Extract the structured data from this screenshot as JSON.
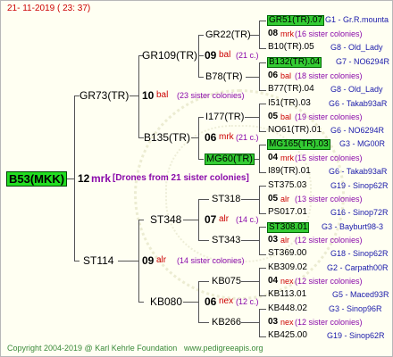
{
  "header": {
    "date": "21- 11-2019 ( 23: 37)"
  },
  "footer": {
    "copyright": "Copyright 2004-2019 @ Karl Kehrle Foundation",
    "site": "www.pedigreeapis.org"
  },
  "colors": {
    "highlight": "#33cc33",
    "code": "#1a1aaa",
    "breed_note": "#cc0000"
  },
  "root": {
    "name": "B53(MKK)",
    "num": "12",
    "race": "mrk",
    "note": "[Drones from 21 sister colonies]"
  },
  "gen1": {
    "sire": {
      "name": "GR73(TR)",
      "num": "10",
      "race": "bal",
      "colonies": "(23 sister colonies)"
    },
    "dam": {
      "name": "ST114",
      "num": "09",
      "race": "alr",
      "colonies": "(14 sister colonies)"
    }
  },
  "gen2": {
    "ss": {
      "name": "GR109(TR)",
      "num": "09",
      "race": "bal",
      "colonies": "(21 c.)"
    },
    "sd": {
      "name": "B135(TR)",
      "num": "06",
      "race": "mrk",
      "colonies": "(21 c.)"
    },
    "ds": {
      "name": "ST348",
      "num": "07",
      "race": "alr",
      "colonies": "(14 c.)"
    },
    "dd": {
      "name": "KB080",
      "num": "06",
      "race": "nex",
      "colonies": "(12 c.)"
    }
  },
  "gen3": [
    {
      "name": "GR22(TR)"
    },
    {
      "name": "B78(TR)"
    },
    {
      "name": "I177(TR)"
    },
    {
      "name": "MG60(TR)"
    },
    {
      "name": "ST318"
    },
    {
      "name": "ST343"
    },
    {
      "name": "KB075"
    },
    {
      "name": "KB266"
    }
  ],
  "gen4": [
    {
      "top": "GR51(TR).07",
      "top_code": "G1 - Gr.R.mounta",
      "num": "08",
      "race": "mrk",
      "colonies": "(16 sister colonies)",
      "bottom": "B10(TR).05",
      "bottom_code": "G8 - Old_Lady"
    },
    {
      "top": "B132(TR).04",
      "top_code": "G7 - NO6294R",
      "num": "06",
      "race": "bal",
      "colonies": "(18 sister colonies)",
      "bottom": "B77(TR).04",
      "bottom_code": "G8 - Old_Lady"
    },
    {
      "top": "I51(TR).03",
      "top_code": "G6 - Takab93aR",
      "num": "05",
      "race": "bal",
      "colonies": "(19 sister colonies)",
      "bottom": "NO61(TR).01",
      "bottom_code": "G6 - NO6294R"
    },
    {
      "top": "MG165(TR).03",
      "top_code": "G3 - MG00R",
      "num": "04",
      "race": "mrk",
      "colonies": "(15 sister colonies)",
      "bottom": "I89(TR).01",
      "bottom_code": "G6 - Takab93aR"
    },
    {
      "top": "ST375.03",
      "top_code": "G19 - Sinop62R",
      "num": "05",
      "race": "alr",
      "colonies": "(13 sister colonies)",
      "bottom": "PS017.01",
      "bottom_code": "G16 - Sinop72R"
    },
    {
      "top": "ST308.01",
      "top_code": "G3 - Bayburt98-3",
      "num": "03",
      "race": "alr",
      "colonies": "(12 sister colonies)",
      "bottom": "ST369.00",
      "bottom_code": "G18 - Sinop62R"
    },
    {
      "top": "KB309.02",
      "top_code": "G2 - Carpath00R",
      "num": "04",
      "race": "nex",
      "colonies": "(12 sister colonies)",
      "bottom": "KB113.01",
      "bottom_code": "G5 - Maced93R"
    },
    {
      "top": "KB448.02",
      "top_code": "G3 - Sinop96R",
      "num": "03",
      "race": "nex",
      "colonies": "(12 sister colonies)",
      "bottom": "KB425.00",
      "bottom_code": "G19 - Sinop62R"
    }
  ]
}
